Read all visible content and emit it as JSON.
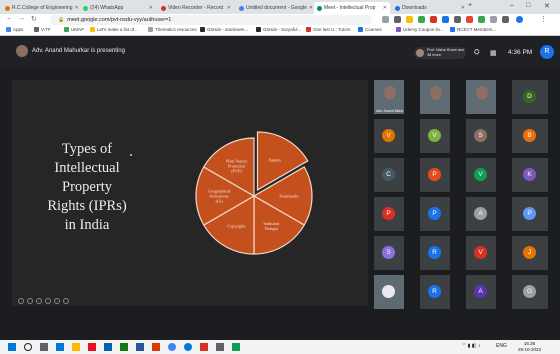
{
  "browser": {
    "tabs": [
      {
        "title": "R.C.College of Engineering",
        "color": "#e37400"
      },
      {
        "title": "(24) WhatsApp",
        "color": "#25d366"
      },
      {
        "title": "Video Recorder - Record",
        "color": "#d93025"
      },
      {
        "title": "Untitled document - Google",
        "color": "#4285f4"
      },
      {
        "title": "Meet - Intellectual Prop",
        "color": "#00897b"
      },
      {
        "title": "Downloads",
        "color": "#1a73e8"
      }
    ],
    "new_tab": "+",
    "window_controls": {
      "min": "–",
      "max": "□",
      "close": "✕"
    },
    "url": "meet.google.com/pvt-nsdu-vyy/authuser=1",
    "bookmarks": [
      "Apps",
      "V-TF",
      "UMAP",
      "Let's make a list of...",
      "Thematics resources",
      "GitHub - aranlowm...",
      "GitHub - Suryaful...",
      "One last U.: Tutors",
      "Courses",
      "Udemy Coupon lin...",
      "RCECT Members..."
    ]
  },
  "meet": {
    "presenter_text": "Adv. Anand Mahurkar is presenting",
    "self_label": "Prof. Nisha Khare and 38 more",
    "clock": "4:36 PM",
    "self_initial": "R",
    "participants": [
      {
        "kind": "video",
        "label": "Adv. Anand Mahu"
      },
      {
        "kind": "video"
      },
      {
        "kind": "video"
      },
      {
        "initial": "D",
        "color": "#33691e"
      },
      {
        "initial": "V",
        "color": "#e37400"
      },
      {
        "initial": "V",
        "color": "#7cb342"
      },
      {
        "initial": "S",
        "color": "#8d6e63"
      },
      {
        "initial": "B",
        "color": "#e8710a"
      },
      {
        "initial": "C",
        "color": "#455a64"
      },
      {
        "initial": "P",
        "color": "#e64a19"
      },
      {
        "initial": "V",
        "color": "#0f9d58"
      },
      {
        "initial": "K",
        "color": "#7e57c2"
      },
      {
        "initial": "P",
        "color": "#d93025"
      },
      {
        "initial": "P",
        "color": "#1a73e8"
      },
      {
        "initial": "A",
        "color": "#9aa0a6"
      },
      {
        "initial": "P",
        "color": "#5e97f6"
      },
      {
        "initial": "S",
        "color": "#8e6fdf"
      },
      {
        "initial": "R",
        "color": "#1a73e8"
      },
      {
        "initial": "V",
        "color": "#d93025"
      },
      {
        "initial": "J",
        "color": "#e37400"
      },
      {
        "kind": "photo"
      },
      {
        "initial": "R",
        "color": "#1a73e8"
      },
      {
        "initial": "A",
        "color": "#5e35b1"
      },
      {
        "initial": "G",
        "color": "#9aa0a6"
      }
    ]
  },
  "slide": {
    "title_lines": [
      "Types of",
      "Intellectual",
      "Property",
      "Rights (IPRs)",
      "in India"
    ],
    "slices": [
      {
        "label_lines": [
          "Patents"
        ]
      },
      {
        "label_lines": [
          "Trademarks"
        ]
      },
      {
        "label_lines": [
          "Industrial",
          "Designs"
        ]
      },
      {
        "label_lines": [
          "Copyrights"
        ]
      },
      {
        "label_lines": [
          "Geographical",
          "Indications",
          "(GI)"
        ]
      },
      {
        "label_lines": [
          "Plant Variety",
          "Protection",
          "(PVP)"
        ]
      }
    ],
    "slice_color": "#c4501e",
    "slice_stroke": "#f2d9c8"
  },
  "taskbar": {
    "tray_text": "ENG",
    "time": "16:36",
    "date": "29-10-2023"
  }
}
